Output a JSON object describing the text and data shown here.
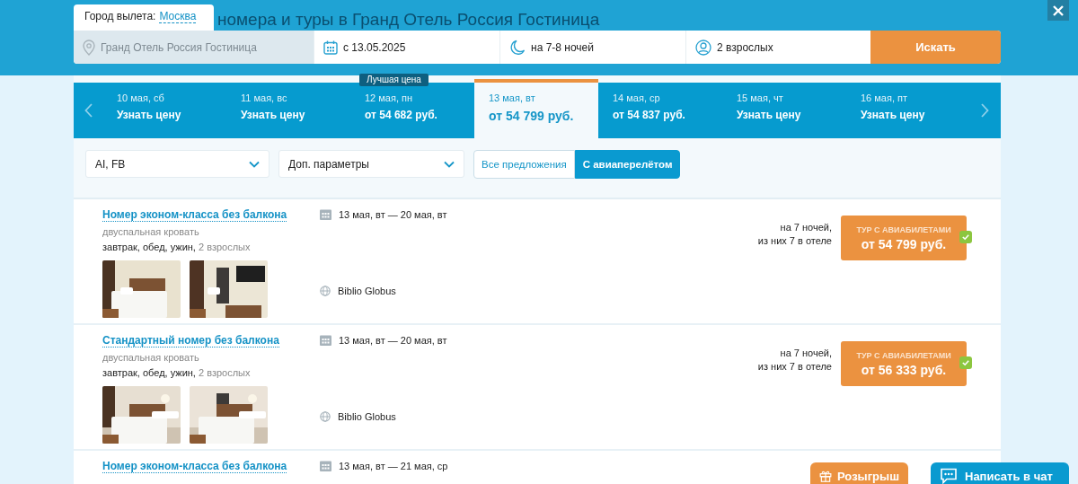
{
  "header": {
    "departure_label": "Город вылета:",
    "departure_city": "Москва",
    "title": "номера и туры в Гранд Отель Россия Гостиница"
  },
  "search": {
    "hotel": "Гранд Отель Россия Гостиница",
    "date": "с 13.05.2025",
    "nights": "на 7-8 ночей",
    "guests": "2 взрослых",
    "button": "Искать"
  },
  "date_strip": {
    "badge": "Лучшая цена",
    "days": [
      {
        "date": "10 мая, сб",
        "price": "Узнать цену",
        "selected": false,
        "best": false
      },
      {
        "date": "11 мая, вс",
        "price": "Узнать цену",
        "selected": false,
        "best": false
      },
      {
        "date": "12 мая, пн",
        "price": "от 54 682 руб.",
        "selected": false,
        "best": true
      },
      {
        "date": "13 мая, вт",
        "price": "от 54 799 руб.",
        "selected": true,
        "best": false
      },
      {
        "date": "14 мая, ср",
        "price": "от 54 837 руб.",
        "selected": false,
        "best": false
      },
      {
        "date": "15 мая, чт",
        "price": "Узнать цену",
        "selected": false,
        "best": false
      },
      {
        "date": "16 мая, пт",
        "price": "Узнать цену",
        "selected": false,
        "best": false
      }
    ]
  },
  "filters": {
    "selects": [
      {
        "value": "AI, FB"
      },
      {
        "value": "Доп. параметры"
      }
    ],
    "toggles": [
      {
        "label": "Все предложения",
        "selected": false
      },
      {
        "label": "С авиаперелётом",
        "selected": true
      }
    ]
  },
  "offers": [
    {
      "title": "Номер эконом-класса без балкона",
      "bed": "двуспальная кровать",
      "meals": "завтрак, обед, ужин,",
      "guests": "2 взрослых",
      "dates": "13 мая, вт — 20 мая, вт",
      "operator": "Biblio Globus",
      "nights": "на 7 ночей,",
      "nights_detail": "из них 7 в отеле",
      "button_label": "ТУР С АВИАБИЛЕТАМИ",
      "price": "от 54 799 руб.",
      "checked": true
    },
    {
      "title": "Стандартный номер без балкона",
      "bed": "двуспальная кровать",
      "meals": "завтрак, обед, ужин,",
      "guests": "2 взрослых",
      "dates": "13 мая, вт — 20 мая, вт",
      "operator": "Biblio Globus",
      "nights": "на 7 ночей,",
      "nights_detail": "из них 7 в отеле",
      "button_label": "ТУР С АВИАБИЛЕТАМИ",
      "price": "от 56 333 руб.",
      "checked": true
    },
    {
      "title": "Номер эконом-класса без балкона",
      "dates": "13 мая, вт — 21 мая, ср"
    }
  ],
  "floating": {
    "giveaway": "Розыгрыш",
    "chat": "Написать в чат"
  }
}
